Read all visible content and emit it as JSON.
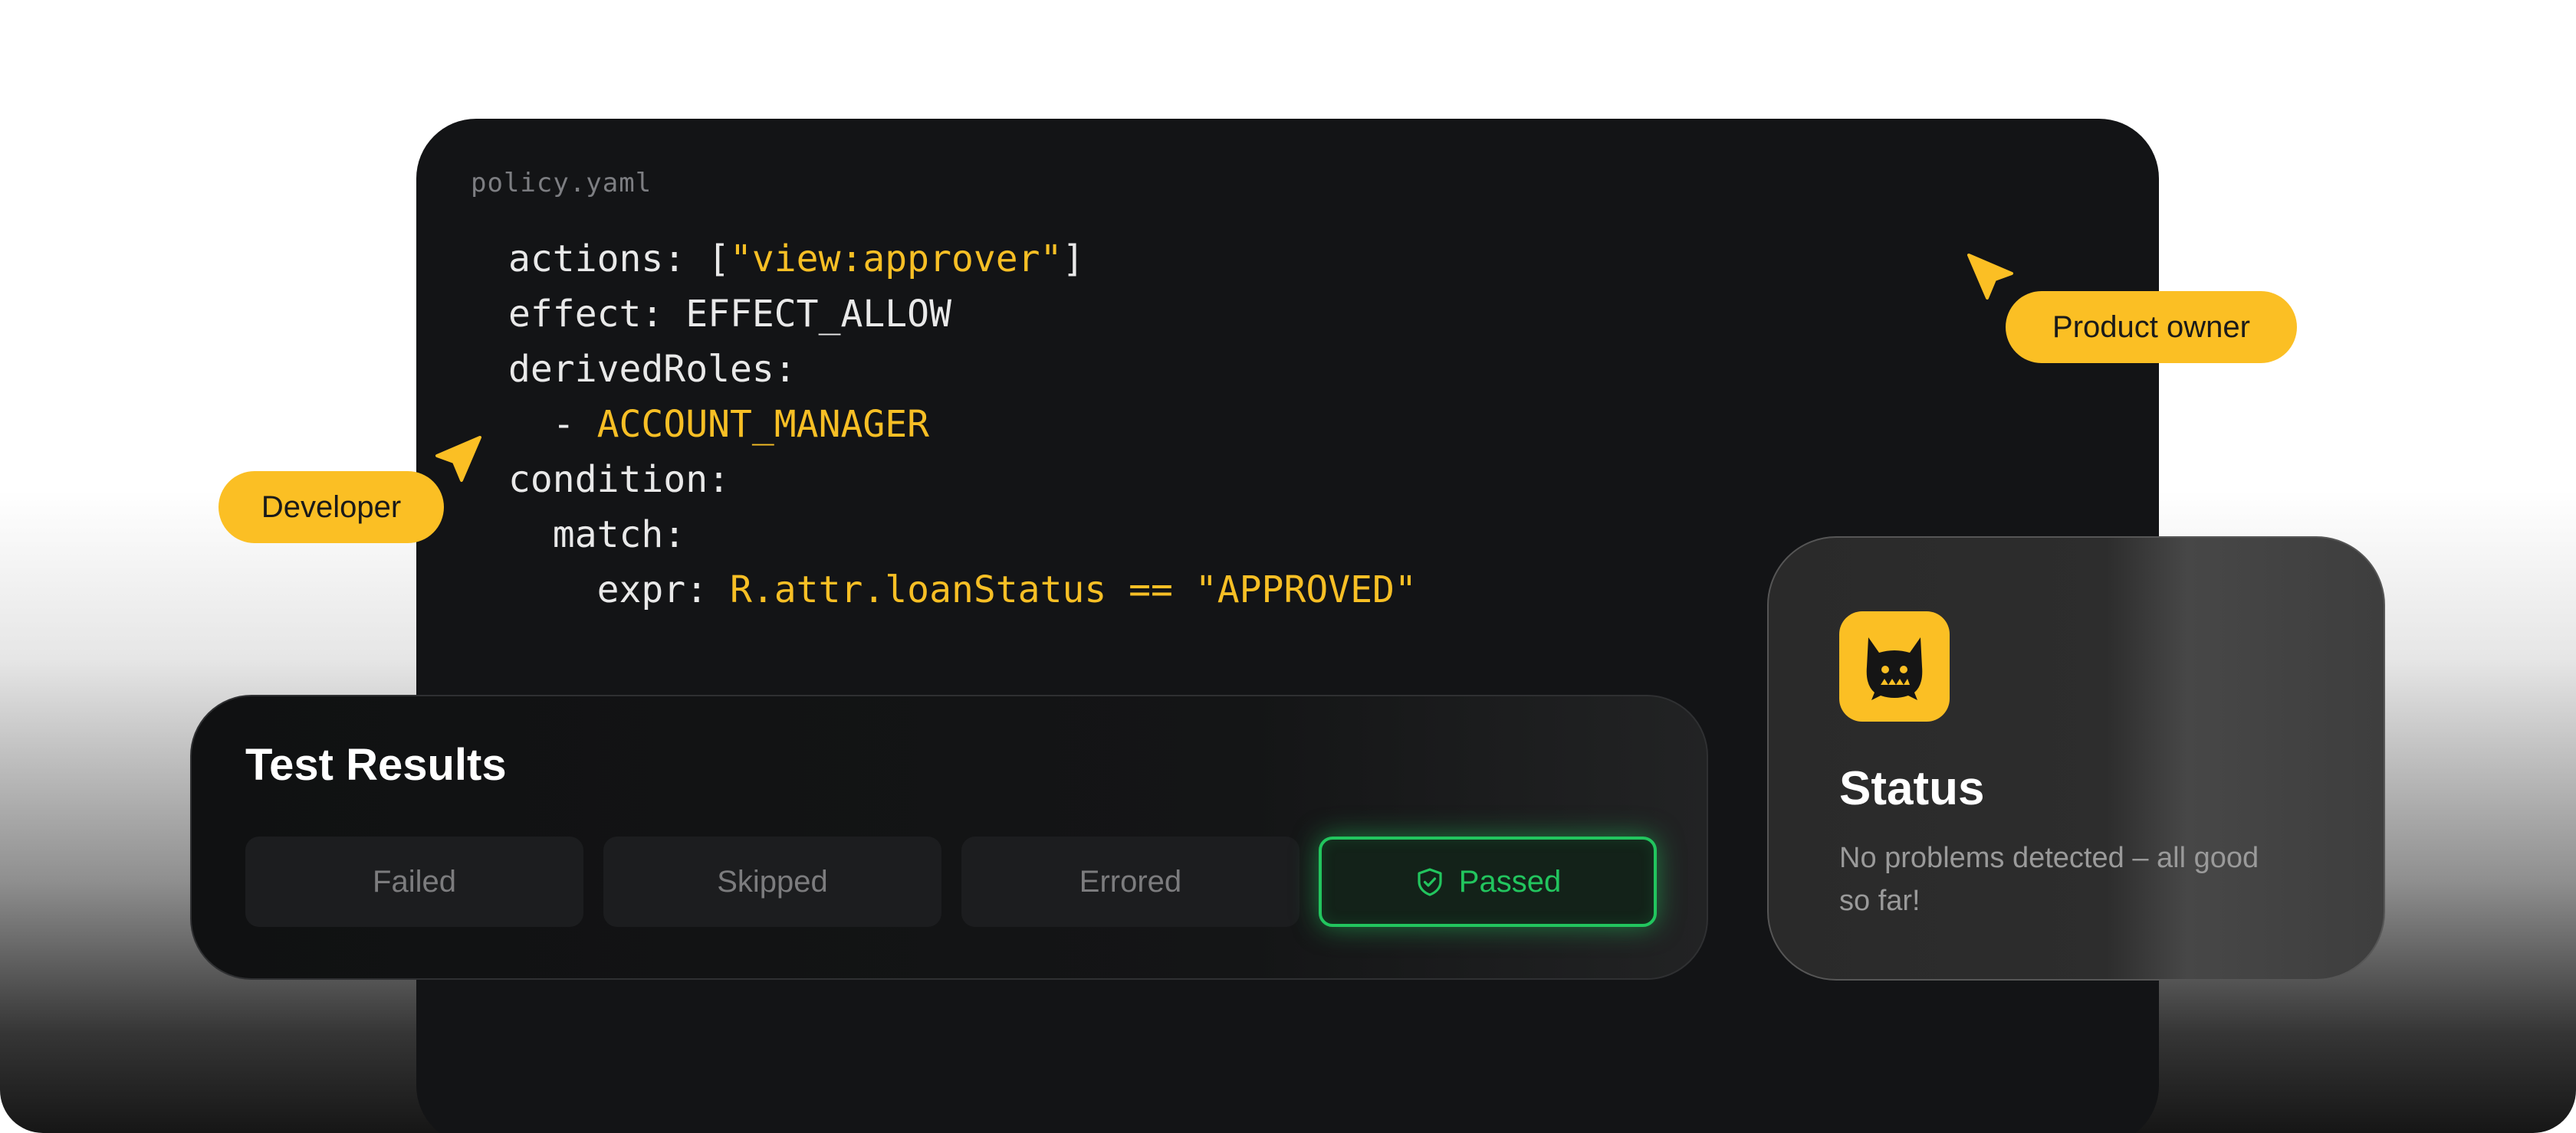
{
  "editor": {
    "filename": "policy.yaml",
    "code_lines": [
      {
        "segments": [
          {
            "text": "actions: [",
            "hl": false
          },
          {
            "text": "\"view:approver\"",
            "hl": true
          },
          {
            "text": "]",
            "hl": false
          }
        ]
      },
      {
        "segments": [
          {
            "text": "effect: EFFECT_ALLOW",
            "hl": false
          }
        ]
      },
      {
        "segments": [
          {
            "text": "derivedRoles:",
            "hl": false
          }
        ]
      },
      {
        "segments": [
          {
            "text": "  - ",
            "hl": false
          },
          {
            "text": "ACCOUNT_MANAGER",
            "hl": true
          }
        ]
      },
      {
        "segments": [
          {
            "text": "condition:",
            "hl": false
          }
        ]
      },
      {
        "segments": [
          {
            "text": "  match:",
            "hl": false
          }
        ]
      },
      {
        "segments": [
          {
            "text": "    expr: ",
            "hl": false
          },
          {
            "text": "R.attr.loanStatus == \"APPROVED\"",
            "hl": true
          }
        ]
      }
    ]
  },
  "labels": {
    "developer": "Developer",
    "product_owner": "Product owner"
  },
  "test_results": {
    "title": "Test Results",
    "failed": "Failed",
    "skipped": "Skipped",
    "errored": "Errored",
    "passed": "Passed"
  },
  "status": {
    "title": "Status",
    "message": "No problems detected – all good so far!"
  },
  "colors": {
    "accent": "#fbbf24",
    "success": "#22c55e",
    "editor_bg": "#131416"
  },
  "icons": {
    "cursor": "pointer-arrow-icon",
    "shield": "shield-check-icon",
    "mascot": "cat-mascot-icon"
  }
}
